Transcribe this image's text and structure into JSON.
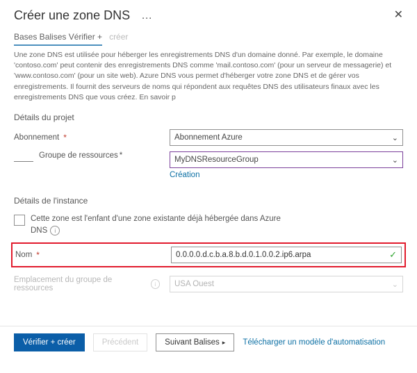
{
  "header": {
    "title": "Créer une zone DNS",
    "dots": "…"
  },
  "tabs": {
    "group": "Bases Balises Vérifier +",
    "create": "créer"
  },
  "description": "Une zone DNS est utilisée pour héberger les enregistrements DNS d'un domaine donné. Par exemple, le domaine 'contoso.com' peut contenir des enregistrements DNS comme 'mail.contoso.com' (pour un serveur de messagerie) et 'www.contoso.com' (pour un site web). Azure DNS vous permet d'héberger votre zone DNS et de gérer vos enregistrements. Il fournit des serveurs de noms qui répondent aux requêtes DNS des utilisateurs finaux avec les enregistrements DNS que vous créez. En savoir p",
  "project": {
    "section_title": "Détails du projet",
    "subscription_label": "Abonnement",
    "subscription_value": "Abonnement Azure",
    "resource_group_label": "Groupe de ressources",
    "resource_group_value": "MyDNSResourceGroup",
    "create_link": "Création"
  },
  "instance": {
    "section_title": "Détails de l'instance",
    "checkbox_label": "Cette zone est l'enfant d'une zone existante déjà hébergée dans Azure",
    "dns_label": "DNS",
    "name_label": "Nom",
    "name_value": "0.0.0.0.d.c.b.a.8.b.d.0.1.0.0.2.ip6.arpa",
    "location_label": "Emplacement du groupe de ressources",
    "location_value": "USA Ouest"
  },
  "footer": {
    "verify": "Vérifier + créer",
    "previous": "Précédent",
    "next": "Suivant Balises",
    "download": "Télécharger un modèle d'automatisation"
  },
  "glyphs": {
    "required": "*",
    "chevron": "⌄",
    "check": "✓",
    "info": "i",
    "arrow": "▸",
    "close": "✕"
  }
}
